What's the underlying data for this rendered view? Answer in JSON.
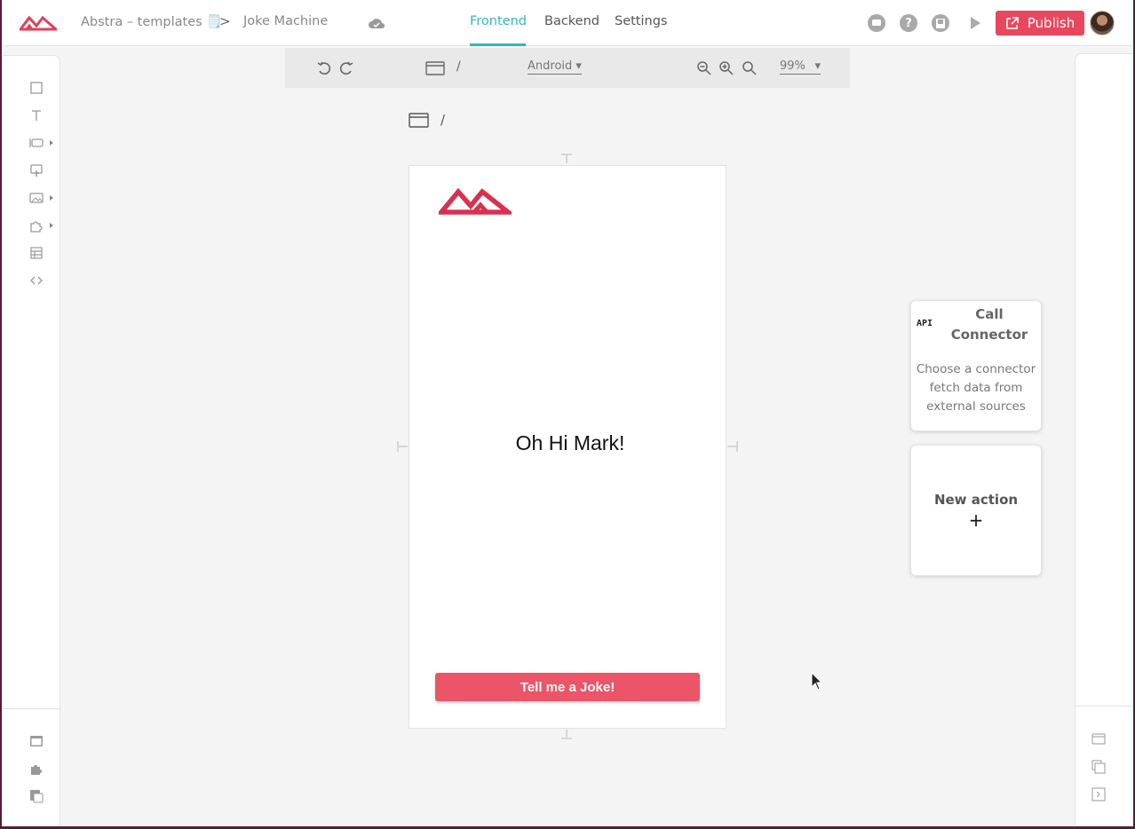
{
  "header": {
    "project_name": "Abstra – templates 🗒️",
    "breadcrumb_separator": ">",
    "page_name": "Joke Machine",
    "tabs": [
      {
        "label": "Frontend",
        "active": true
      },
      {
        "label": "Backend",
        "active": false
      },
      {
        "label": "Settings",
        "active": false
      }
    ],
    "help_glyph": "?",
    "publish_label": "Publish",
    "accent_color": "#36b5b9",
    "publish_color": "#e8485e"
  },
  "left_sidebar": {
    "icons": [
      "container-icon",
      "text-icon",
      "input-icon",
      "touch-icon",
      "image-icon",
      "puzzle-icon",
      "table-icon",
      "code-icon"
    ],
    "bottom_icons": [
      "window-icon",
      "plugin-icon",
      "pages-icon"
    ]
  },
  "toolbar": {
    "path": "/",
    "device": "Android",
    "zoom": "99%"
  },
  "canvas": {
    "page_path": "/",
    "greeting": "Oh Hi Mark!",
    "button_label": "Tell me a Joke!",
    "button_color": "#ec5468"
  },
  "actions": {
    "connector_badge": "API",
    "connector_title": "Call Connector",
    "connector_desc": "Choose a connector fetch data from external sources",
    "new_action_title": "New action",
    "new_action_plus": "+"
  }
}
